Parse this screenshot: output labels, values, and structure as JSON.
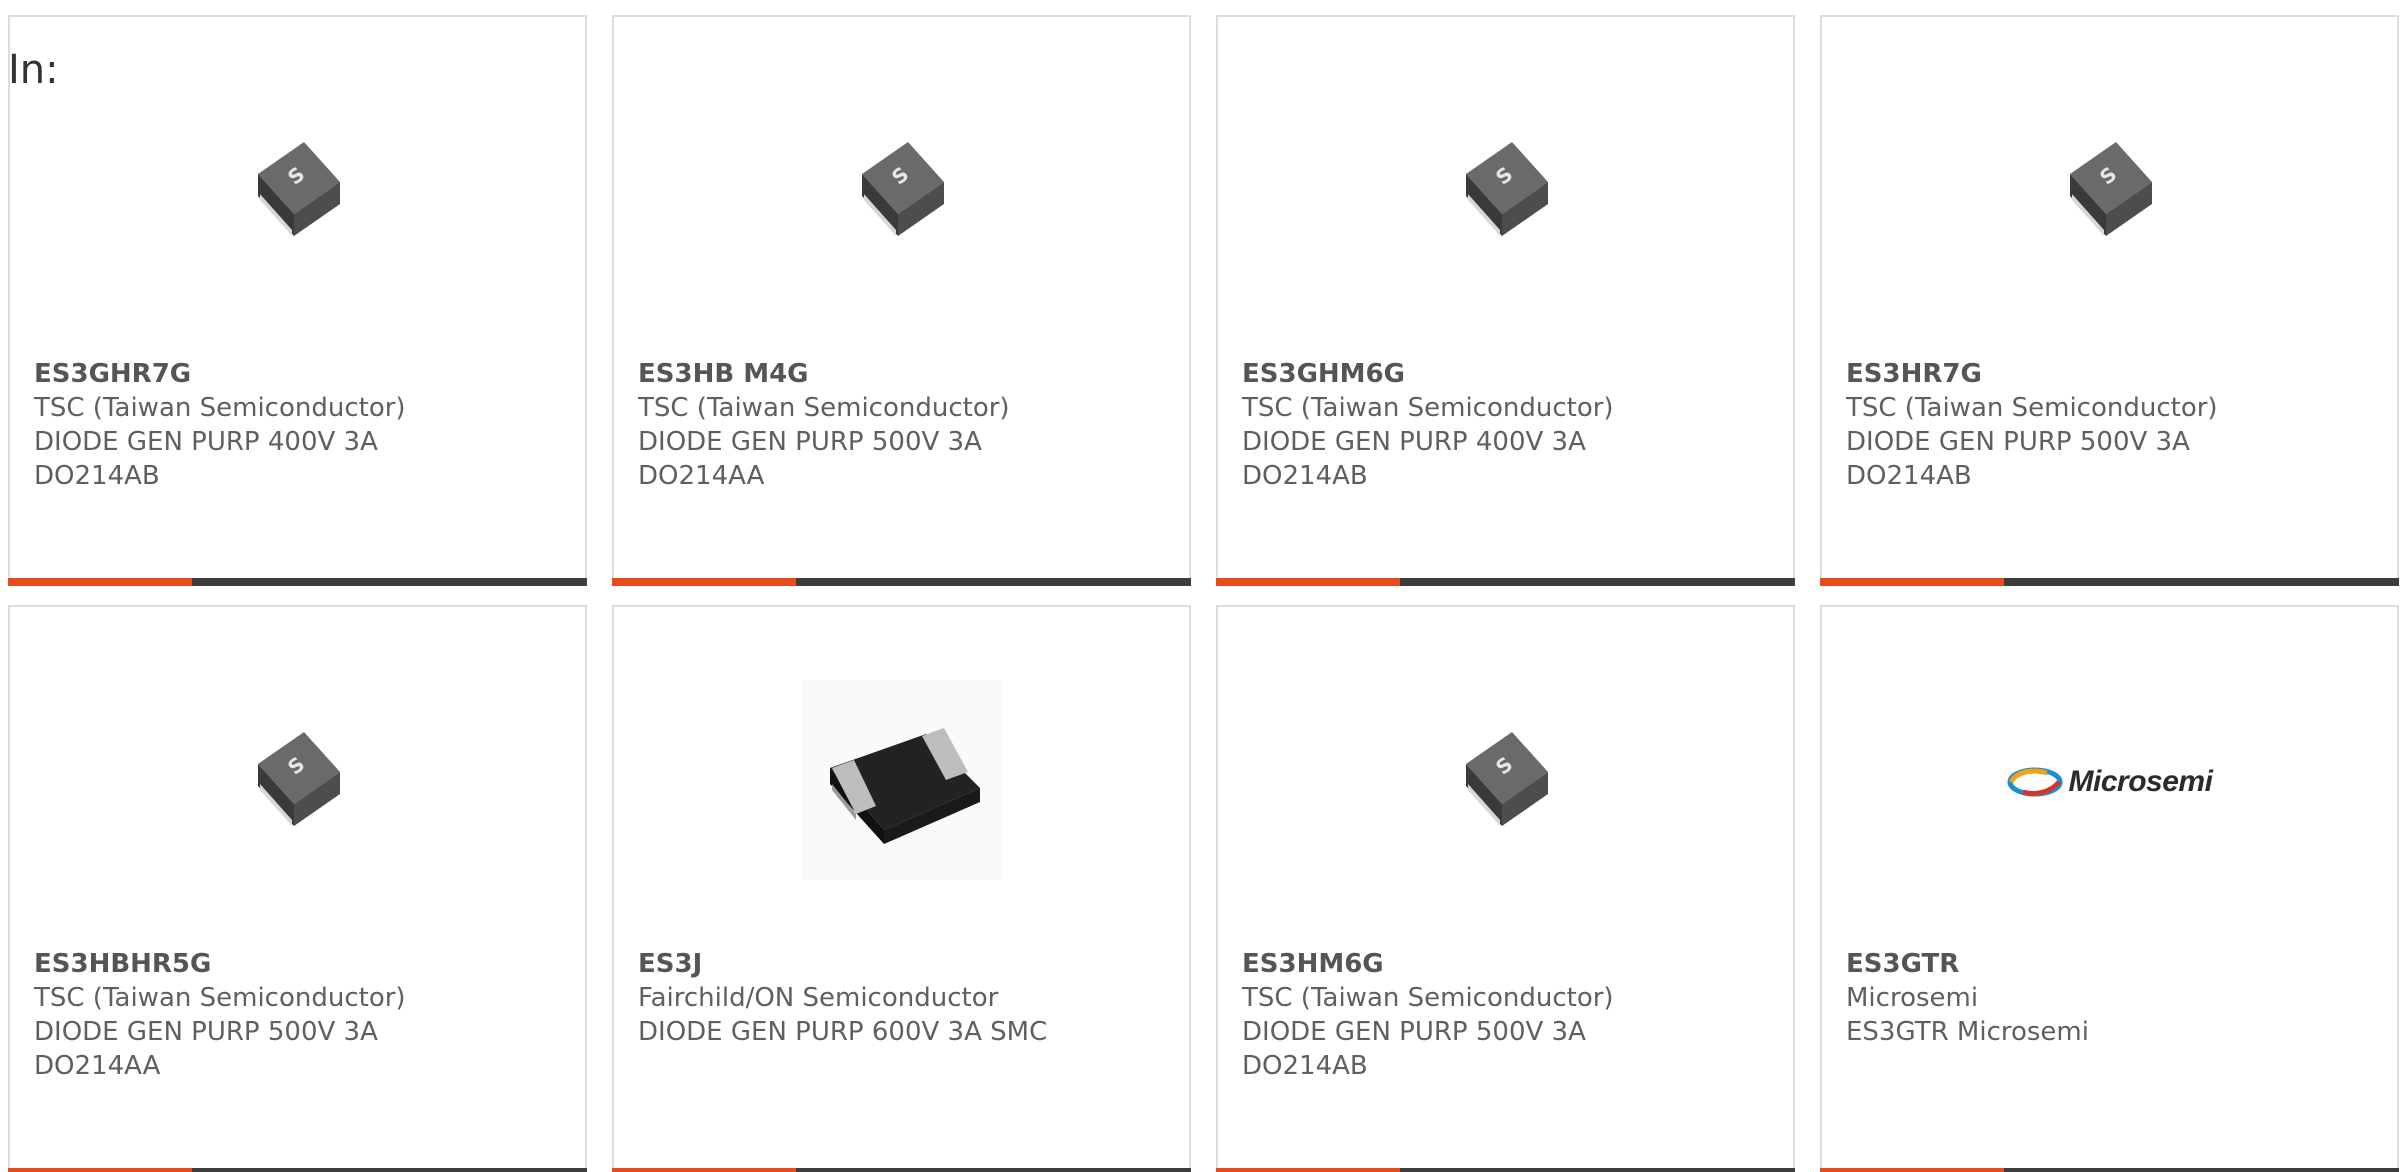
{
  "filter": {
    "label": "In:"
  },
  "products": [
    {
      "part_number": "ES3GHR7G",
      "manufacturer": "TSC (Taiwan Semiconductor)",
      "description": "DIODE GEN PURP 400V 3A",
      "package": "DO214AB",
      "image_icon": "tsc-smd-diode-icon"
    },
    {
      "part_number": "ES3HB M4G",
      "manufacturer": "TSC (Taiwan Semiconductor)",
      "description": "DIODE GEN PURP 500V 3A",
      "package": "DO214AA",
      "image_icon": "tsc-smd-diode-icon"
    },
    {
      "part_number": "ES3GHM6G",
      "manufacturer": "TSC (Taiwan Semiconductor)",
      "description": "DIODE GEN PURP 400V 3A",
      "package": "DO214AB",
      "image_icon": "tsc-smd-diode-icon"
    },
    {
      "part_number": "ES3HR7G",
      "manufacturer": "TSC (Taiwan Semiconductor)",
      "description": "DIODE GEN PURP 500V 3A",
      "package": "DO214AB",
      "image_icon": "tsc-smd-diode-icon"
    },
    {
      "part_number": "ES3HBHR5G",
      "manufacturer": "TSC (Taiwan Semiconductor)",
      "description": "DIODE GEN PURP 500V 3A",
      "package": "DO214AA",
      "image_icon": "tsc-smd-diode-icon"
    },
    {
      "part_number": "ES3J",
      "manufacturer": "Fairchild/ON Semiconductor",
      "description": "DIODE GEN PURP 600V 3A SMC",
      "package": "",
      "image_icon": "smc-diode-package-icon"
    },
    {
      "part_number": "ES3HM6G",
      "manufacturer": "TSC (Taiwan Semiconductor)",
      "description": "DIODE GEN PURP 500V 3A",
      "package": "DO214AB",
      "image_icon": "tsc-smd-diode-icon"
    },
    {
      "part_number": "ES3GTR",
      "manufacturer": "Microsemi",
      "description": "ES3GTR Microsemi",
      "package": "",
      "image_icon": "microsemi-logo",
      "logo_text": "Microsemi"
    }
  ],
  "colors": {
    "accent_bar": "#e84b1c",
    "bar_dark": "#3d3d3d",
    "card_border": "#dddddd"
  }
}
